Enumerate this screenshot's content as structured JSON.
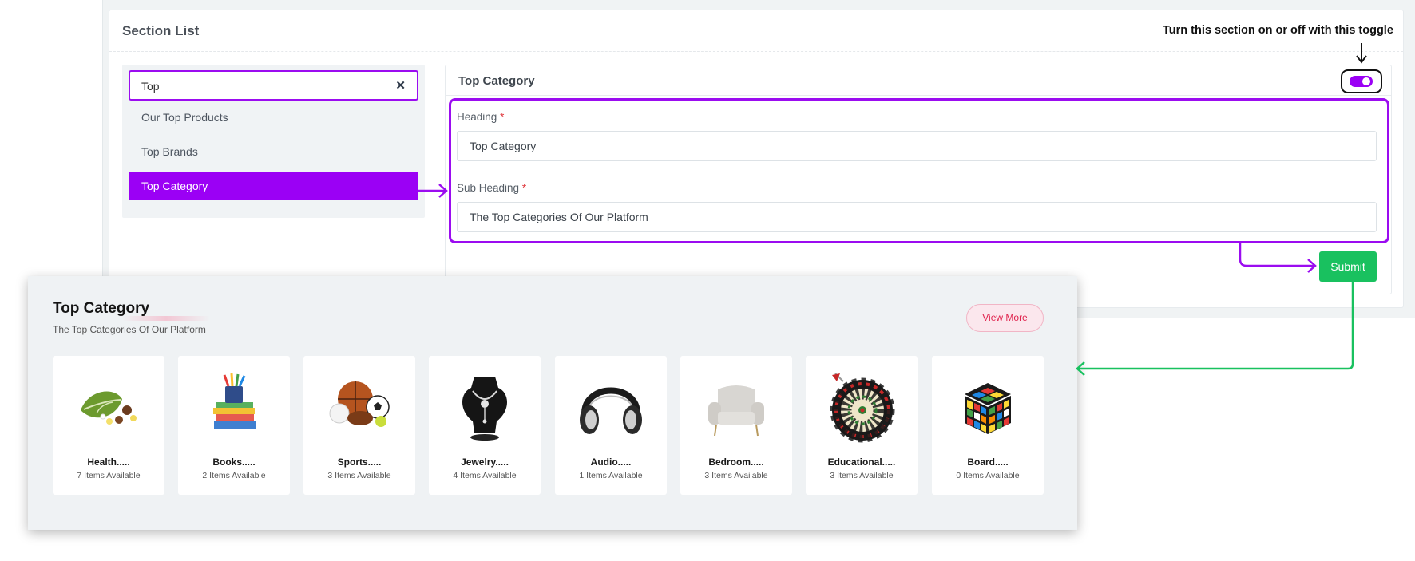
{
  "section_list": {
    "title": "Section List",
    "search": {
      "value": "Top"
    },
    "items": [
      {
        "label": "Our Top Products"
      },
      {
        "label": "Top Brands"
      },
      {
        "label": "Top Category"
      }
    ]
  },
  "form": {
    "title": "Top Category",
    "toggle_on": true,
    "heading_label": "Heading",
    "heading_value": "Top Category",
    "subheading_label": "Sub Heading",
    "subheading_value": "The Top Categories Of Our Platform",
    "required_mark": "*",
    "submit_label": "Submit"
  },
  "annotation": {
    "toggle_hint": "Turn this section on or off with this toggle"
  },
  "colors": {
    "accent": "#9b00f5",
    "submit": "#19c15f",
    "view_more": "#e0244e"
  },
  "preview": {
    "title": "Top Category",
    "subtitle": "The Top Categories Of Our Platform",
    "view_more_label": "View More",
    "categories": [
      {
        "name": "Health.....",
        "count": "7 Items Available",
        "icon": "health-leaf-icon"
      },
      {
        "name": "Books.....",
        "count": "2 Items Available",
        "icon": "books-icon"
      },
      {
        "name": "Sports.....",
        "count": "3 Items Available",
        "icon": "sports-balls-icon"
      },
      {
        "name": "Jewelry.....",
        "count": "4 Items Available",
        "icon": "jewelry-necklace-icon"
      },
      {
        "name": "Audio.....",
        "count": "1 Items Available",
        "icon": "headphones-icon"
      },
      {
        "name": "Bedroom.....",
        "count": "3 Items Available",
        "icon": "armchair-icon"
      },
      {
        "name": "Educational.....",
        "count": "3 Items Available",
        "icon": "dartboard-icon"
      },
      {
        "name": "Board.....",
        "count": "0 Items Available",
        "icon": "rubiks-cube-icon"
      }
    ]
  }
}
